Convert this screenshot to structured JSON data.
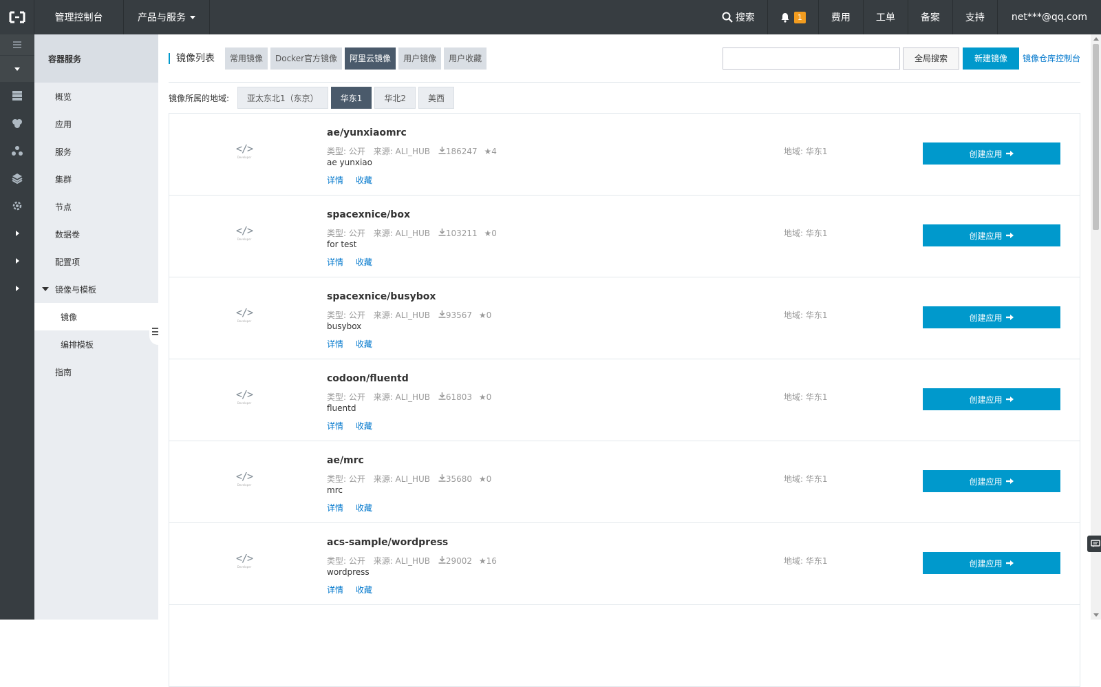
{
  "topbar": {
    "console": "管理控制台",
    "products": "产品与服务",
    "search": "搜索",
    "notification_count": "1",
    "billing": "费用",
    "ticket": "工单",
    "icp": "备案",
    "support": "支持",
    "user": "net***@qq.com"
  },
  "sidebar": {
    "title": "容器服务",
    "items": [
      "概览",
      "应用",
      "服务",
      "集群",
      "节点",
      "数据卷",
      "配置项"
    ],
    "group": "镜像与模板",
    "sub_items": [
      "镜像",
      "编排模板"
    ],
    "guide": "指南"
  },
  "toolbar": {
    "title": "镜像列表",
    "tabs": [
      "常用镜像",
      "Docker官方镜像",
      "阿里云镜像",
      "用户镜像",
      "用户收藏"
    ],
    "active_tab": "阿里云镜像",
    "search_placeholder": "",
    "global_search": "全局搜索",
    "new_image": "新建镜像",
    "repo_console": "镜像仓库控制台"
  },
  "region_filter": {
    "label": "镜像所属的地域:",
    "options": [
      "亚太东北1（东京）",
      "华东1",
      "华北2",
      "美西"
    ],
    "active": "华东1"
  },
  "images": [
    {
      "name": "ae/yunxiaomrc",
      "type": "类型: 公开",
      "source": "来源: ALI_HUB",
      "downloads": "186247",
      "stars": "4",
      "desc": "ae yunxiao",
      "region": "地域: 华东1"
    },
    {
      "name": "spacexnice/box",
      "type": "类型: 公开",
      "source": "来源: ALI_HUB",
      "downloads": "103211",
      "stars": "0",
      "desc": "for test",
      "region": "地域: 华东1"
    },
    {
      "name": "spacexnice/busybox",
      "type": "类型: 公开",
      "source": "来源: ALI_HUB",
      "downloads": "93567",
      "stars": "0",
      "desc": "busybox",
      "region": "地域: 华东1"
    },
    {
      "name": "codoon/fluentd",
      "type": "类型: 公开",
      "source": "来源: ALI_HUB",
      "downloads": "61803",
      "stars": "0",
      "desc": "fluentd",
      "region": "地域: 华东1"
    },
    {
      "name": "ae/mrc",
      "type": "类型: 公开",
      "source": "来源: ALI_HUB",
      "downloads": "35680",
      "stars": "0",
      "desc": "mrc",
      "region": "地域: 华东1"
    },
    {
      "name": "acs-sample/wordpress",
      "type": "类型: 公开",
      "source": "来源: ALI_HUB",
      "downloads": "29002",
      "stars": "16",
      "desc": "wordpress",
      "region": "地域: 华东1"
    }
  ],
  "row_labels": {
    "details": "详情",
    "favorite": "收藏",
    "create_app": "创建应用",
    "thumb_code": "</>",
    "thumb_caption": "Developer"
  },
  "colors": {
    "topbar": "#373d41",
    "accent": "#0099cc",
    "active_tab": "#4a5a6b",
    "badge": "#f29c1f"
  }
}
